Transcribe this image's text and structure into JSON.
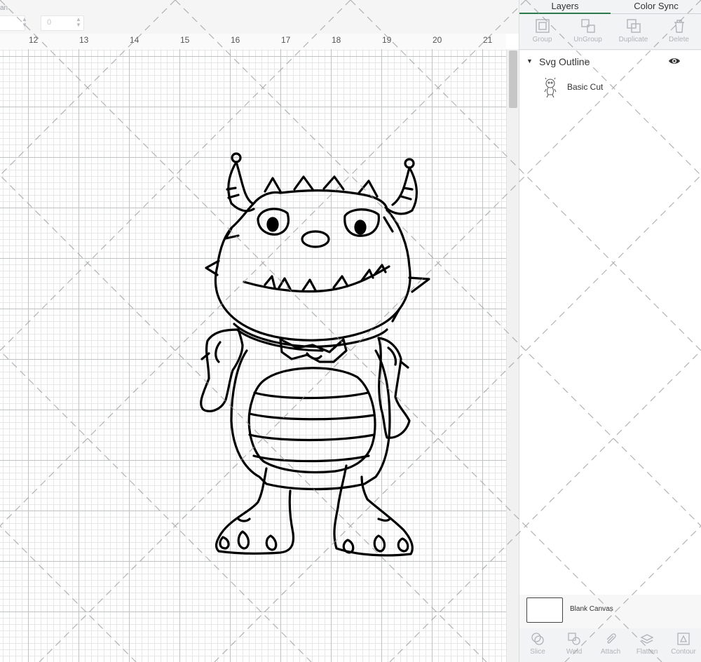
{
  "toolbar_top": {
    "partial_label": "an",
    "field2_value": "0"
  },
  "ruler": {
    "ticks": [
      "12",
      "13",
      "14",
      "15",
      "16",
      "17",
      "18",
      "19",
      "20",
      "21"
    ]
  },
  "panel": {
    "tabs": {
      "layers": "Layers",
      "color_sync": "Color Sync"
    },
    "tools": {
      "group": "Group",
      "ungroup": "UnGroup",
      "duplicate": "Duplicate",
      "delete": "Delete"
    },
    "layer_group": {
      "name": "Svg Outline",
      "caret_icon": "triangle-down-icon",
      "visibility_icon": "eye-icon"
    },
    "layer_item": {
      "name": "Basic Cut",
      "thumbnail_icon": "monster-thumbnail-icon"
    },
    "blank_canvas": {
      "label": "Blank Canvas"
    },
    "bottom_tools": {
      "slice": "Slice",
      "weld": "Weld",
      "attach": "Attach",
      "flatten": "Flatten",
      "contour": "Contour"
    }
  },
  "colors": {
    "accent": "#2b7a4b",
    "panel_bg": "#f2f3f4",
    "grid_major": "#bfc2c5",
    "grid_minor": "#e6e7e8"
  }
}
